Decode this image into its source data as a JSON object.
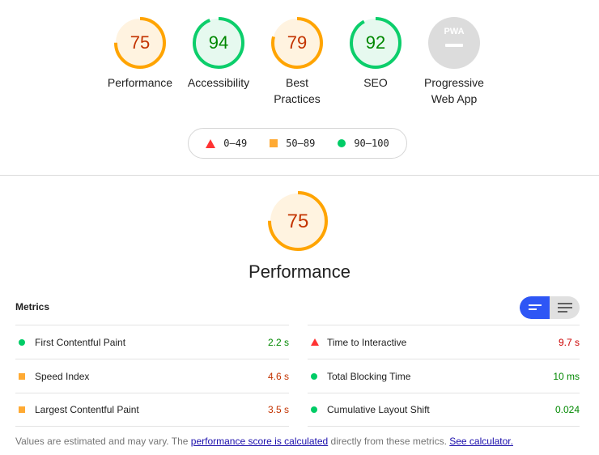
{
  "colors": {
    "orange": "#ffa400",
    "green": "#0cce6b",
    "red": "#ff4e42",
    "orange_bg": "#fff3e0",
    "green_bg": "#e6f9ef",
    "pwa_bg": "#dcdcdc",
    "accent_blue": "#2e56f5"
  },
  "categories": [
    {
      "score": "75",
      "value": 75,
      "label": "Performance",
      "level": "orange"
    },
    {
      "score": "94",
      "value": 94,
      "label": "Accessibility",
      "level": "green"
    },
    {
      "score": "79",
      "value": 79,
      "label": "Best Practices",
      "level": "orange"
    },
    {
      "score": "92",
      "value": 92,
      "label": "SEO",
      "level": "green"
    },
    {
      "score": "",
      "value": null,
      "label": "Progressive Web App",
      "badge": "PWA",
      "level": "gray"
    }
  ],
  "legend": {
    "fail": "0–49",
    "average": "50–89",
    "pass": "90–100"
  },
  "performance": {
    "score": "75",
    "value": 75,
    "title": "Performance"
  },
  "metrics": {
    "title": "Metrics",
    "left": [
      {
        "name": "First Contentful Paint",
        "value": "2.2 s",
        "level": "green",
        "icon": "circle-icon"
      },
      {
        "name": "Speed Index",
        "value": "4.6 s",
        "level": "orange",
        "icon": "square-icon"
      },
      {
        "name": "Largest Contentful Paint",
        "value": "3.5 s",
        "level": "orange",
        "icon": "square-icon"
      }
    ],
    "right": [
      {
        "name": "Time to Interactive",
        "value": "9.7 s",
        "level": "red",
        "icon": "triangle-icon"
      },
      {
        "name": "Total Blocking Time",
        "value": "10 ms",
        "level": "green",
        "icon": "circle-icon"
      },
      {
        "name": "Cumulative Layout Shift",
        "value": "0.024",
        "level": "green",
        "icon": "circle-icon"
      }
    ]
  },
  "footnote": {
    "prefix": "Values are estimated and may vary. The ",
    "link1": "performance score is calculated",
    "middle": " directly from these metrics. ",
    "link2": "See calculator."
  }
}
